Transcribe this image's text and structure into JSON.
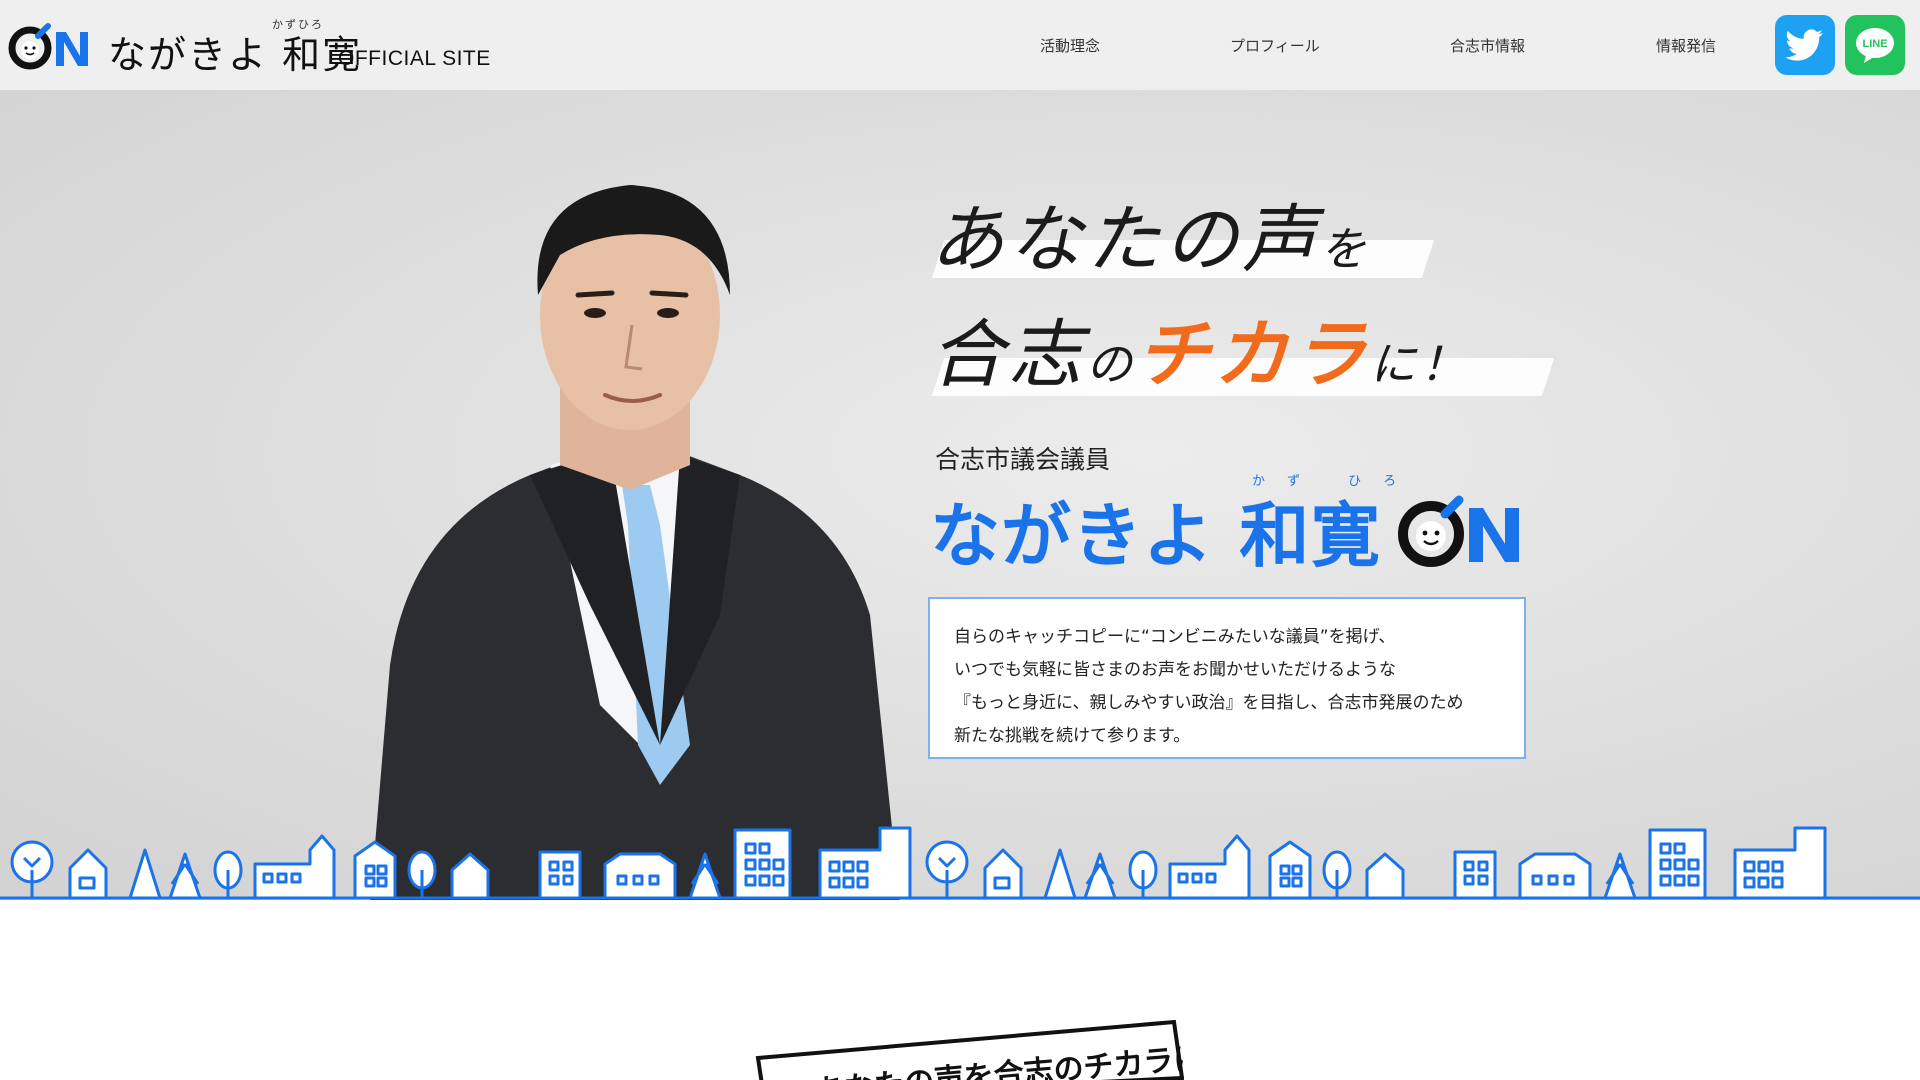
{
  "header": {
    "logo_mark": "ON",
    "site_name": "ながきよ 和寛",
    "site_ruby": "かずひろ",
    "site_suffix": "OFFICIAL SITE",
    "nav": [
      "活動理念",
      "プロフィール",
      "合志市情報",
      "情報発信"
    ],
    "social": {
      "twitter_icon": "twitter-bird-icon",
      "line_label": "LINE",
      "twitter_color": "#1da1f2",
      "line_color": "#22c35d"
    }
  },
  "hero": {
    "catch_line1_a": "あなたの声",
    "catch_line1_b": "を",
    "catch_line2_a": "合志",
    "catch_line2_b": "の",
    "catch_line2_orange": "チカラ",
    "catch_line2_c": "に！",
    "role": "合志市議会議員",
    "name": "ながきよ 和寛",
    "name_ruby": "かず ひろ",
    "name_mark": "ON",
    "description": [
      "自らのキャッチコピーに“コンビニみたいな議員”を掲げ、",
      "いつでも気軽に皆さまのお声をお聞かせいただけるような",
      "『もっと身近に、親しみやすい政治』を目指し、合志市発展のため",
      "新たな挑戦を続けて参ります。"
    ]
  },
  "bottom": {
    "banner_text": "あなたの声を合志のチカラに！"
  },
  "colors": {
    "brand_blue": "#1a73e8",
    "accent_orange": "#f26b1d",
    "header_bg": "#efefef"
  }
}
